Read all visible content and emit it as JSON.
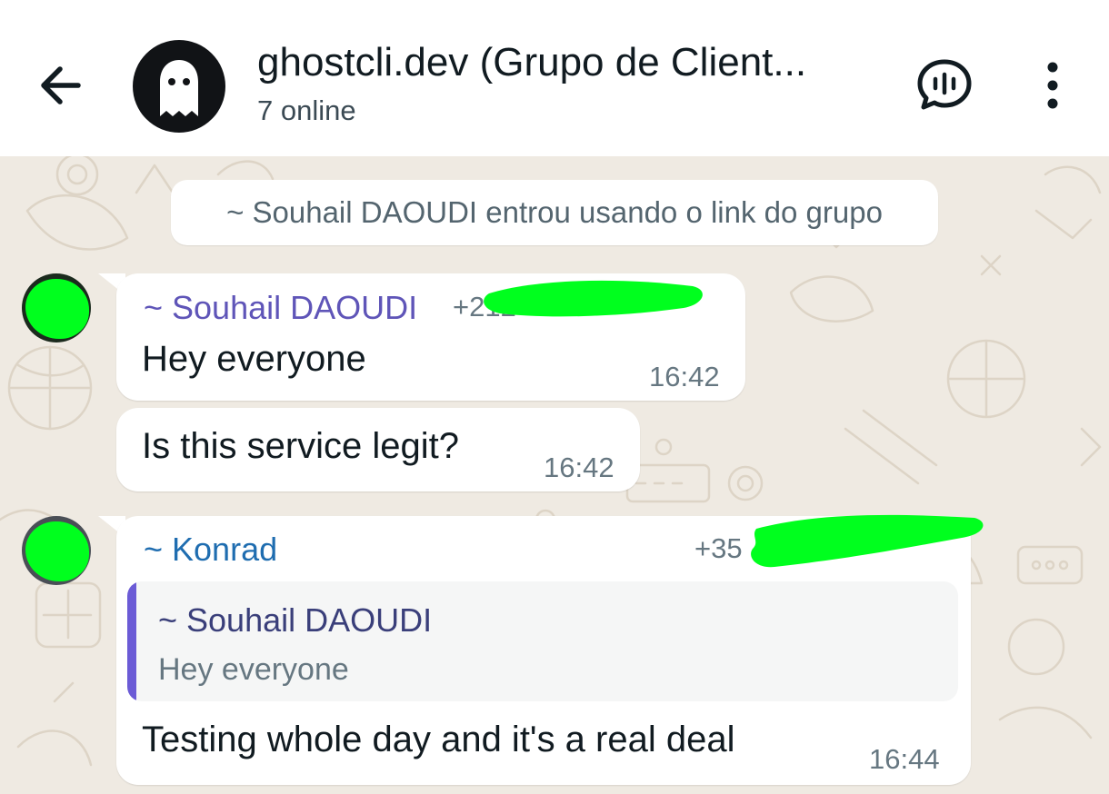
{
  "header": {
    "title": "ghostcli.dev (Grupo de Client...",
    "subtitle": "7 online",
    "icons": {
      "back": "arrow-back-icon",
      "avatar": "ghost-logo",
      "voice": "voice-chat-icon",
      "menu": "more-vertical-icon"
    }
  },
  "system_message": "~ Souhail DAOUDI entrou usando o link do grupo",
  "messages": [
    {
      "sender": "~ Souhail DAOUDI",
      "phone": "+212",
      "text": "Hey everyone",
      "time": "16:42",
      "sender_color": "#5f55b8"
    },
    {
      "text": "Is this service legit?",
      "time": "16:42"
    },
    {
      "sender": "~ Konrad",
      "phone": "+35",
      "sender_color": "#1f6db0",
      "quote": {
        "sender": "~ Souhail DAOUDI",
        "text": "Hey everyone"
      },
      "text": "Testing whole day  and it's a real deal",
      "time": "16:44"
    }
  ],
  "colors": {
    "redaction": "#00ff1e",
    "wallpaper": "#efeae2",
    "quote_accent": "#6b5bd6"
  }
}
